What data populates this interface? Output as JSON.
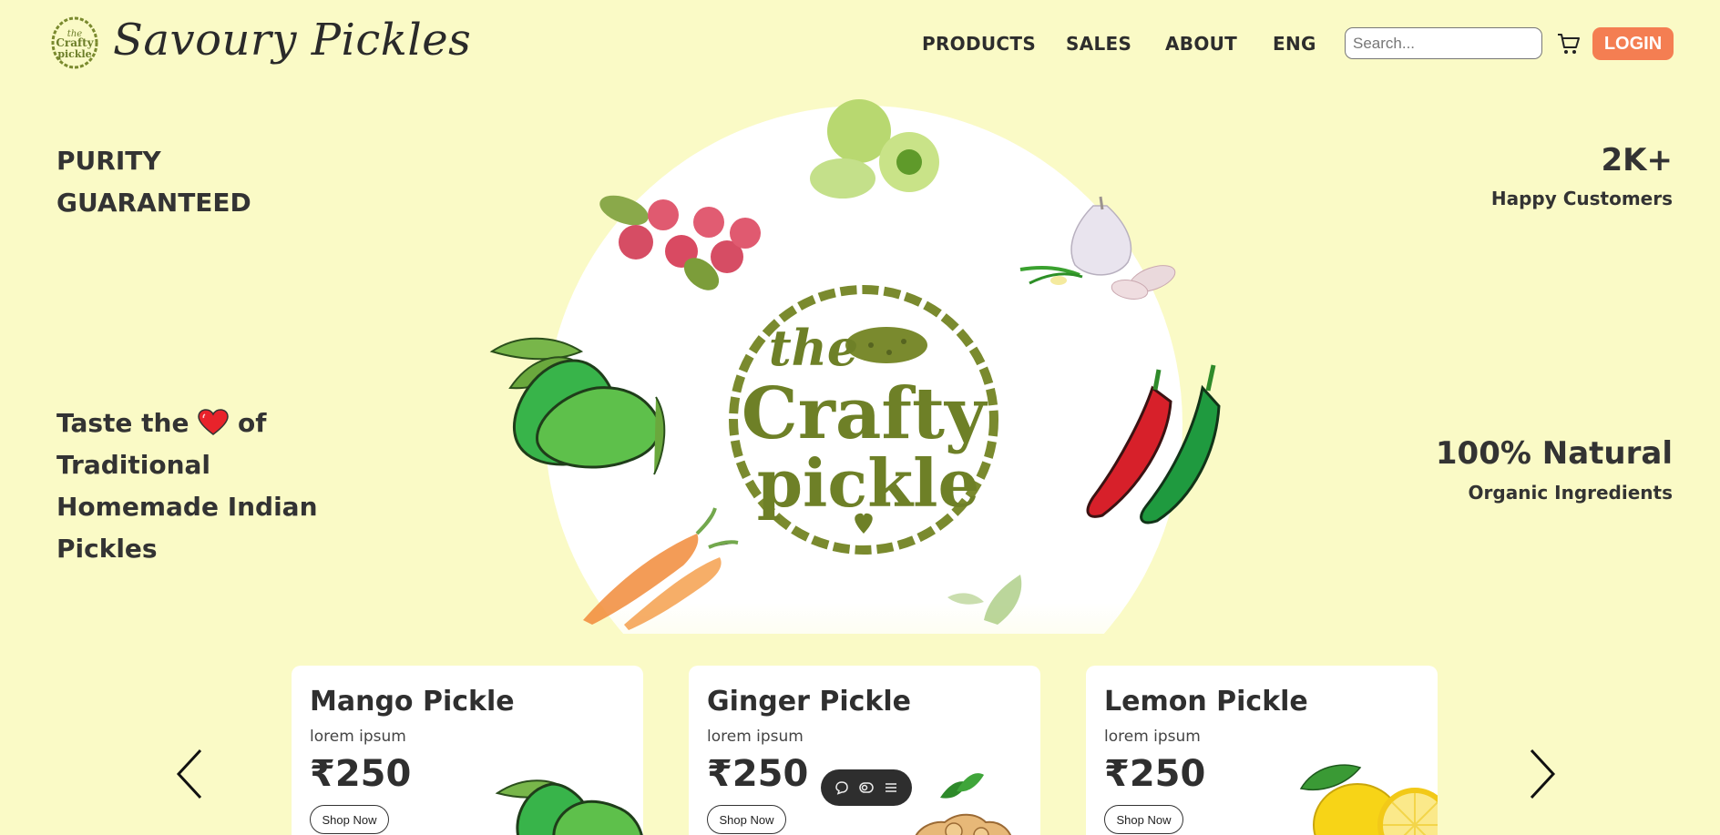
{
  "header": {
    "brand_name": "Savoury Pickles",
    "nav": [
      "PRODUCTS",
      "SALES",
      "ABOUT",
      "ENG"
    ],
    "search_placeholder": "Search...",
    "login_label": "LOGIN"
  },
  "hero": {
    "left_top": "PURITY GUARANTEED",
    "tagline_part1": "Taste the",
    "tagline_part2": "of Traditional Homemade Indian Pickles",
    "stat1_value": "2K+",
    "stat1_label": "Happy Customers",
    "stat2_value": "100% Natural",
    "stat2_label": "Organic Ingredients"
  },
  "products": [
    {
      "name": "Mango Pickle",
      "desc": "lorem ipsum",
      "price": "₹250",
      "button": "Shop Now"
    },
    {
      "name": "Ginger Pickle",
      "desc": "lorem ipsum",
      "price": "₹250",
      "button": "Shop Now"
    },
    {
      "name": "Lemon Pickle",
      "desc": "lorem ipsum",
      "price": "₹250",
      "button": "Shop Now"
    }
  ],
  "colors": {
    "background": "#fafac6",
    "accent": "#f47e52",
    "logo_green": "#7a8a2e"
  },
  "icons": {
    "cart": "cart-icon",
    "prev": "chevron-left-icon",
    "next": "chevron-right-icon",
    "heart": "heart-icon"
  }
}
